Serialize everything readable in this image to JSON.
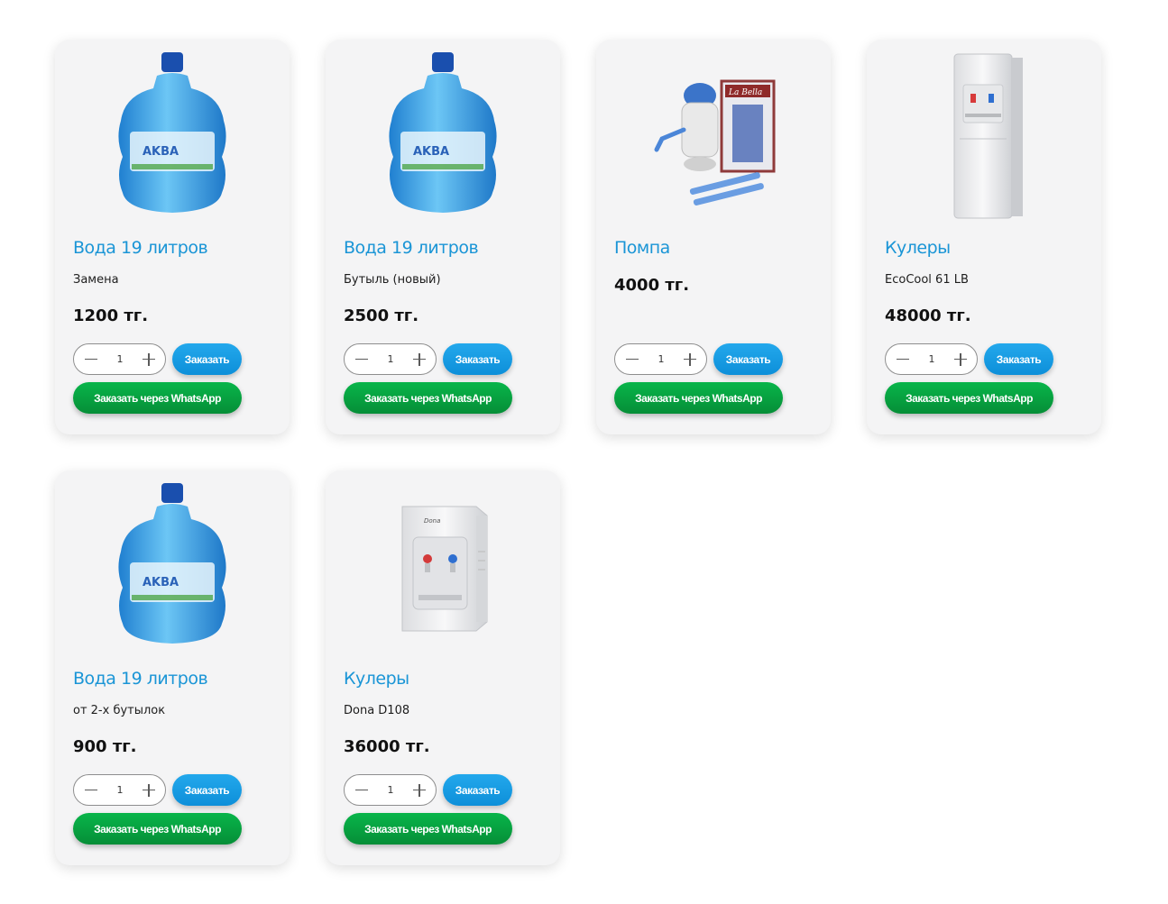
{
  "products": [
    {
      "image": "water-bottle-19l",
      "title": "Вода 19 литров",
      "subtitle": "Замена",
      "price": "1200 тг.",
      "quantity": "1",
      "order_label": "Заказать",
      "whatsapp_label": "Заказать через WhatsApp"
    },
    {
      "image": "water-bottle-19l",
      "title": "Вода 19 литров",
      "subtitle": "Бутыль (новый)",
      "price": "2500 тг.",
      "quantity": "1",
      "order_label": "Заказать",
      "whatsapp_label": "Заказать через WhatsApp"
    },
    {
      "image": "hand-pump-la-bella",
      "title": "Помпа",
      "subtitle": "",
      "price": "4000 тг.",
      "quantity": "1",
      "order_label": "Заказать",
      "whatsapp_label": "Заказать через WhatsApp"
    },
    {
      "image": "floor-water-cooler",
      "title": "Кулеры",
      "subtitle": "EcoCool 61 LB",
      "price": "48000 тг.",
      "quantity": "1",
      "order_label": "Заказать",
      "whatsapp_label": "Заказать через WhatsApp"
    },
    {
      "image": "water-bottle-19l",
      "title": "Вода 19 литров",
      "subtitle": "от 2-х бутылок",
      "price": "900 тг.",
      "quantity": "1",
      "order_label": "Заказать",
      "whatsapp_label": "Заказать через WhatsApp"
    },
    {
      "image": "tabletop-water-cooler",
      "title": "Кулеры",
      "subtitle": "Dona D108",
      "price": "36000 тг.",
      "quantity": "1",
      "order_label": "Заказать",
      "whatsapp_label": "Заказать через WhatsApp"
    }
  ],
  "colors": {
    "title": "#1a95d6",
    "order_button": "#1899e0",
    "whatsapp_button": "#07a443",
    "card_background": "#f4f4f5"
  }
}
